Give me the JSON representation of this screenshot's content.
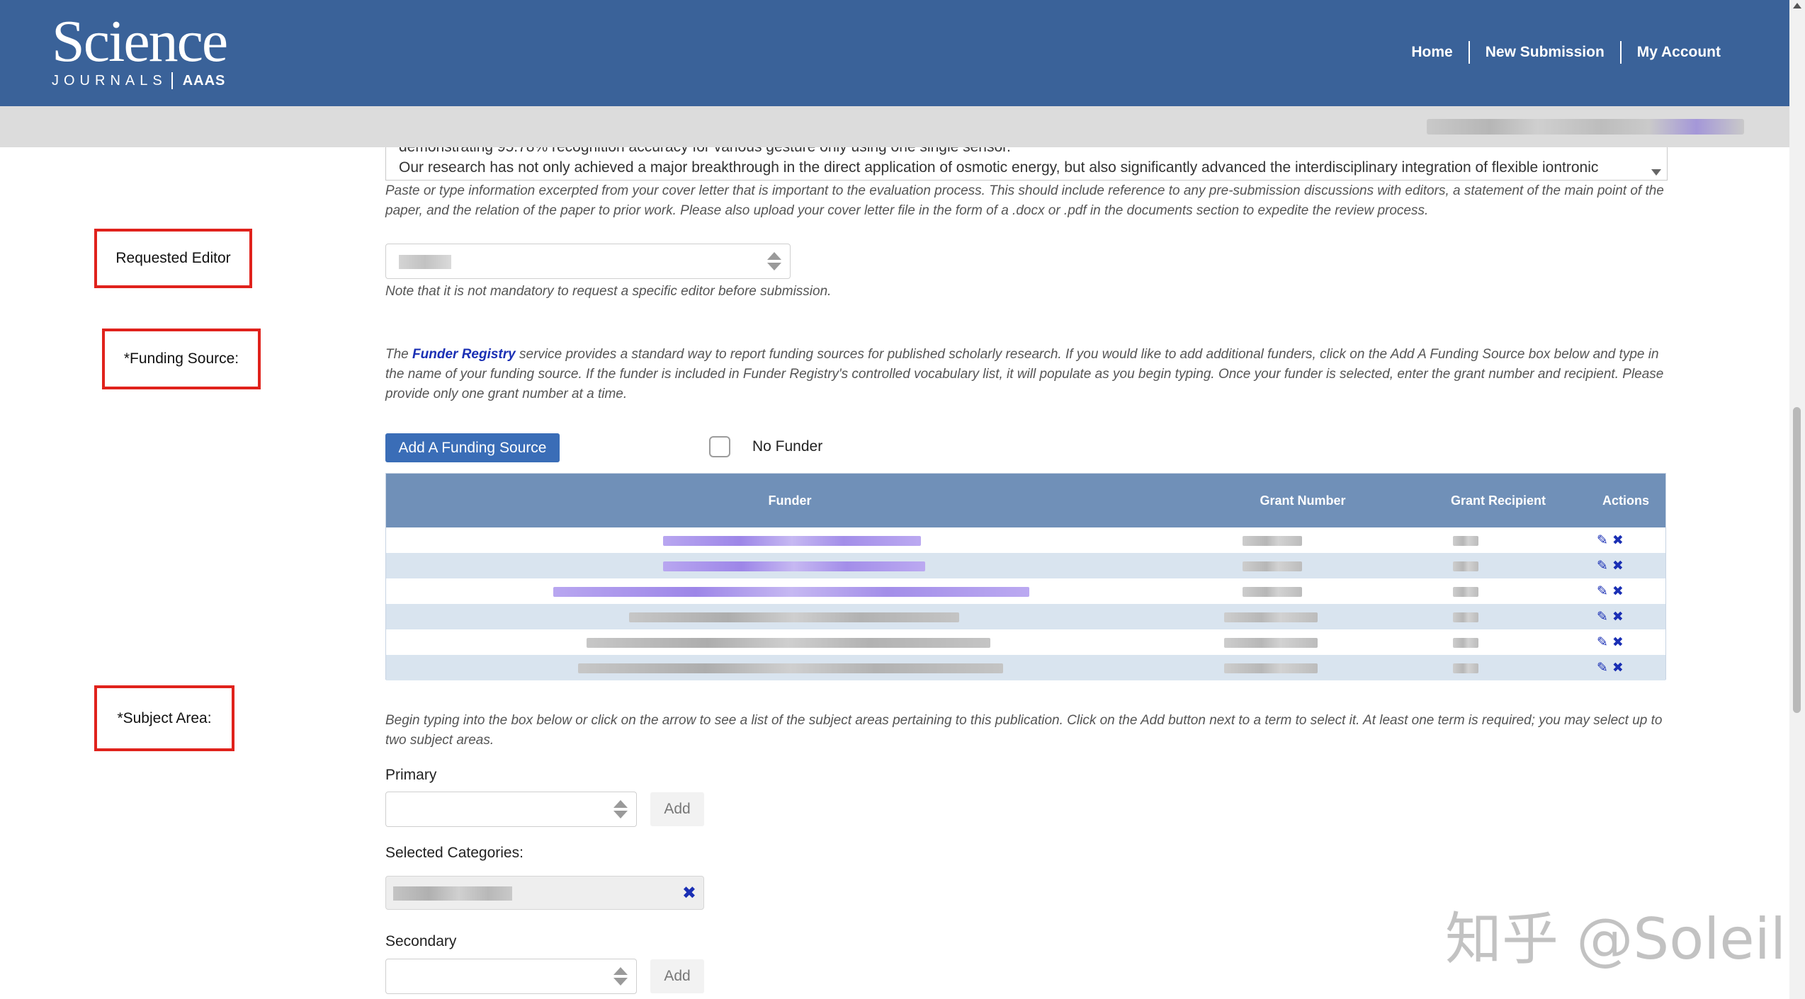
{
  "header": {
    "logo_main": "Science",
    "logo_sub": "JOURNALS",
    "logo_org": "AAAS",
    "nav": [
      "Home",
      "New Submission",
      "My Account"
    ]
  },
  "cover_letter": {
    "line1": "demonstrating 95.78% recognition accuracy for various gesture only using one single sensor.",
    "line2": "Our research has not only achieved a major breakthrough in the direct application of osmotic energy, but also significantly advanced the interdisciplinary integration of flexible iontronic",
    "help": "Paste or type information excerpted from your cover letter that is important to the evaluation process. This should include reference to any pre-submission discussions with editors, a statement of the main point of the paper, and the relation of the paper to prior work. Please also upload your cover letter file in the form of a .docx or .pdf in the documents section to expedite the review process."
  },
  "requested_editor": {
    "label": "Requested Editor",
    "note": "Note that it is not mandatory to request a specific editor before submission."
  },
  "funding": {
    "label": "*Funding Source:",
    "help_prefix": "The ",
    "help_link": "Funder Registry",
    "help_suffix": " service provides a standard way to report funding sources for published scholarly research. If you would like to add additional funders, click on the Add A Funding Source box below and type in the name of your funding source. If the funder is included in Funder Registry's controlled vocabulary list, it will populate as you begin typing. Once your funder is selected, enter the grant number and recipient. Please provide only one grant number at a time.",
    "add_button": "Add A Funding Source",
    "no_funder_label": "No Funder",
    "columns": [
      "Funder",
      "Grant Number",
      "Grant Recipient",
      "Actions"
    ],
    "rows": [
      {
        "funder_kind": "link"
      },
      {
        "funder_kind": "link"
      },
      {
        "funder_kind": "link"
      },
      {
        "funder_kind": "gray"
      },
      {
        "funder_kind": "gray"
      },
      {
        "funder_kind": "gray"
      }
    ]
  },
  "subject_area": {
    "label": "*Subject Area:",
    "help": "Begin typing into the box below or click on the arrow to see a list of the subject areas pertaining to this publication. Click on the Add button next to a term to select it. At least one term is required; you may select up to two subject areas.",
    "primary_label": "Primary",
    "add_label": "Add",
    "selected_label": "Selected Categories:",
    "secondary_label": "Secondary"
  },
  "watermark": "知乎 @Soleil",
  "icons": {
    "edit": "edit-icon",
    "delete": "delete-x-icon",
    "remove": "remove-x-icon"
  },
  "colors": {
    "header": "#3a6299",
    "table_header": "#7090b8",
    "button": "#3a6db7",
    "link": "#1a2fb4",
    "highlight_box": "#e0221c"
  }
}
